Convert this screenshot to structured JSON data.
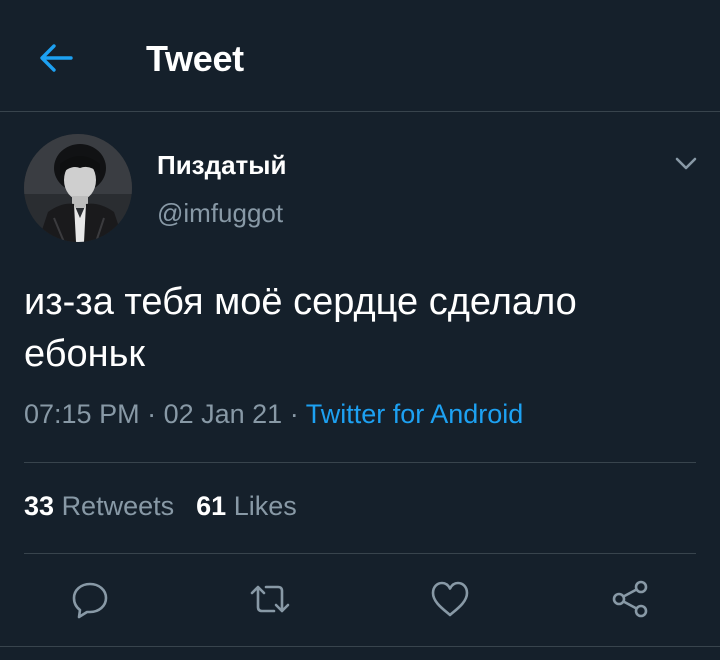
{
  "header": {
    "title": "Tweet",
    "back_icon": "arrow-left-icon"
  },
  "author": {
    "display_name": "Пиздатый",
    "handle": "@imfuggot"
  },
  "tweet": {
    "text": "из-за тебя моё сердце сделало ебоньк"
  },
  "meta": {
    "time": "07:15 PM",
    "separator_1": " · ",
    "date": "02 Jan 21",
    "separator_2": " · ",
    "source": "Twitter for Android"
  },
  "stats": {
    "retweets_count": "33",
    "retweets_label": "Retweets",
    "likes_count": "61",
    "likes_label": "Likes"
  },
  "actions": {
    "icons": [
      "reply-icon",
      "retweet-icon",
      "like-icon",
      "share-icon"
    ]
  },
  "colors": {
    "background": "#15202b",
    "accent": "#1da1f2",
    "secondary_text": "#8899a6",
    "divider": "#38444d"
  }
}
